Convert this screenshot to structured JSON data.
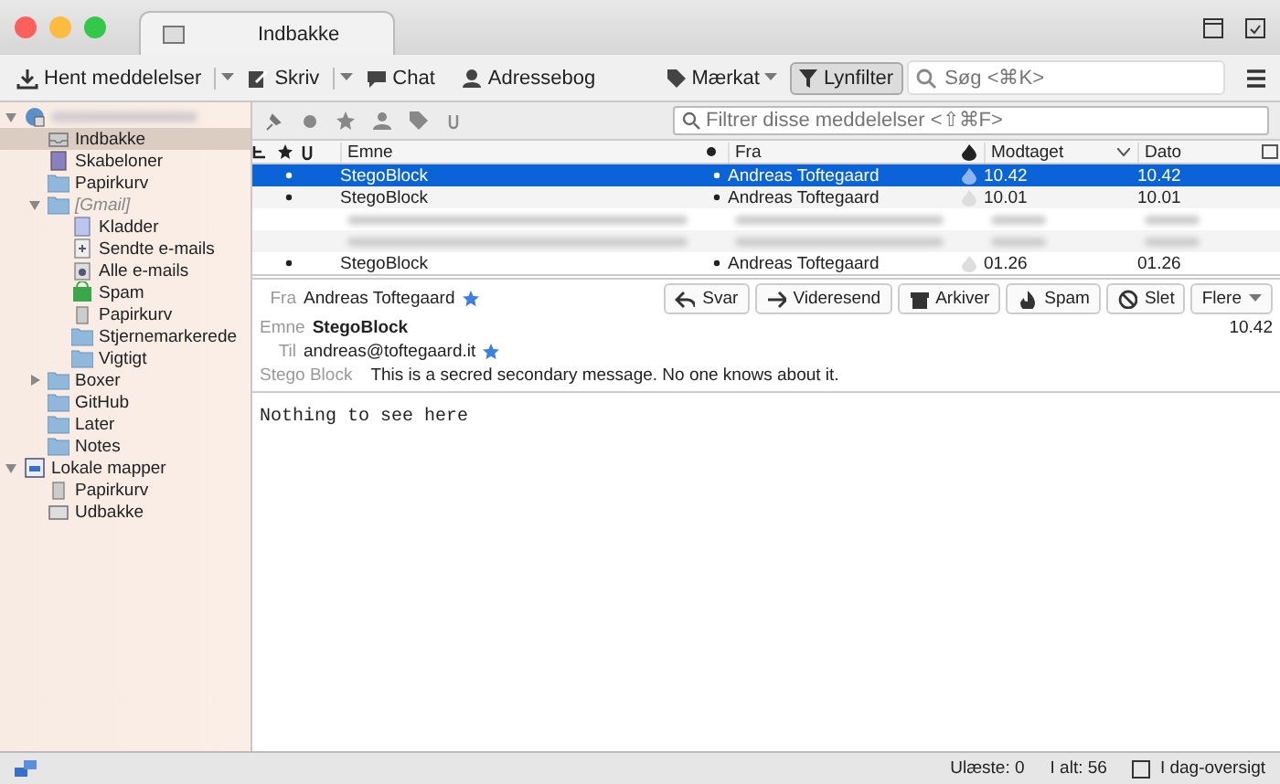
{
  "window": {
    "tab_title": "Indbakke"
  },
  "toolbar": {
    "buttons": [
      {
        "label": "Hent meddelelser",
        "kind": "download",
        "menu": true
      },
      {
        "label": "Skriv",
        "kind": "write",
        "menu": true
      },
      {
        "label": "Chat",
        "kind": "chat",
        "menu": false
      },
      {
        "label": "Adressebog",
        "kind": "person",
        "menu": false
      }
    ],
    "tag_button": {
      "label": "Mærkat"
    },
    "quick_filter": {
      "label": "Lynfilter",
      "on": true
    },
    "search": {
      "placeholder": "Søg <⌘K>"
    }
  },
  "folders": [
    {
      "kind": "account",
      "expanded": true,
      "redacted": true,
      "selected": false,
      "children": [
        {
          "label": "Indbakke",
          "kind": "inbox",
          "selected": true
        },
        {
          "label": "Skabeloner",
          "kind": "templates",
          "selected": false
        },
        {
          "label": "Papirkurv",
          "kind": "folder",
          "selected": false
        },
        {
          "label": "[Gmail]",
          "kind": "folder",
          "expanded": true,
          "virtual": true,
          "selected": false,
          "children": [
            {
              "label": "Kladder",
              "kind": "drafts",
              "selected": false
            },
            {
              "label": "Sendte e-mails",
              "kind": "sent",
              "selected": false
            },
            {
              "label": "Alle e-mails",
              "kind": "archive",
              "selected": false
            },
            {
              "label": "Spam",
              "kind": "spam",
              "selected": false
            },
            {
              "label": "Papirkurv",
              "kind": "trash",
              "selected": false
            },
            {
              "label": "Stjernemarkerede",
              "kind": "folder",
              "selected": false
            },
            {
              "label": "Vigtigt",
              "kind": "folder",
              "selected": false
            }
          ]
        },
        {
          "label": "Boxer",
          "kind": "folder",
          "expanded": false,
          "selected": false
        },
        {
          "label": "GitHub",
          "kind": "folder",
          "selected": false
        },
        {
          "label": "Later",
          "kind": "folder",
          "selected": false
        },
        {
          "label": "Notes",
          "kind": "folder",
          "selected": false
        }
      ]
    },
    {
      "label": "Lokale mapper",
      "kind": "local",
      "expanded": true,
      "selected": false,
      "children": [
        {
          "label": "Papirkurv",
          "kind": "trash",
          "selected": false
        },
        {
          "label": "Udbakke",
          "kind": "outbox",
          "selected": false
        }
      ]
    }
  ],
  "filter": {
    "placeholder": "Filtrer disse meddelelser <⇧⌘F>"
  },
  "table": {
    "columns": [
      "Emne",
      "Fra",
      "Modtaget",
      "Dato"
    ],
    "rows": [
      {
        "kind": "message",
        "subject": "StegoBlock",
        "from": "Andreas Toftegaard",
        "received": "10.42",
        "date": "10.42",
        "selected": true
      },
      {
        "kind": "message",
        "subject": "StegoBlock",
        "from": "Andreas Toftegaard",
        "received": "10.01",
        "date": "10.01",
        "selected": false
      },
      {
        "kind": "redacted",
        "selected": false
      },
      {
        "kind": "redacted",
        "selected": false
      },
      {
        "kind": "message",
        "subject": "StegoBlock",
        "from": "Andreas Toftegaard",
        "received": "01.26",
        "date": "01.26",
        "selected": false
      }
    ]
  },
  "message": {
    "from_label": "Fra",
    "from": "Andreas Toftegaard",
    "subject_label": "Emne",
    "subject": "StegoBlock",
    "to_label": "Til",
    "to": "andreas@toftegaard.it",
    "extra_label": "Stego Block",
    "extra": "This is a secred secondary message. No one knows about it.",
    "time": "10.42",
    "actions": [
      {
        "label": "Svar",
        "kind": "reply"
      },
      {
        "label": "Videresend",
        "kind": "forward"
      },
      {
        "label": "Arkiver",
        "kind": "archive"
      },
      {
        "label": "Spam",
        "kind": "spam"
      },
      {
        "label": "Slet",
        "kind": "delete"
      },
      {
        "label": "Flere",
        "kind": "more"
      }
    ],
    "body": "Nothing to see here"
  },
  "status_bar": {
    "unread": "Ulæste: 0",
    "total": "I alt: 56",
    "today": "I dag-oversigt"
  }
}
